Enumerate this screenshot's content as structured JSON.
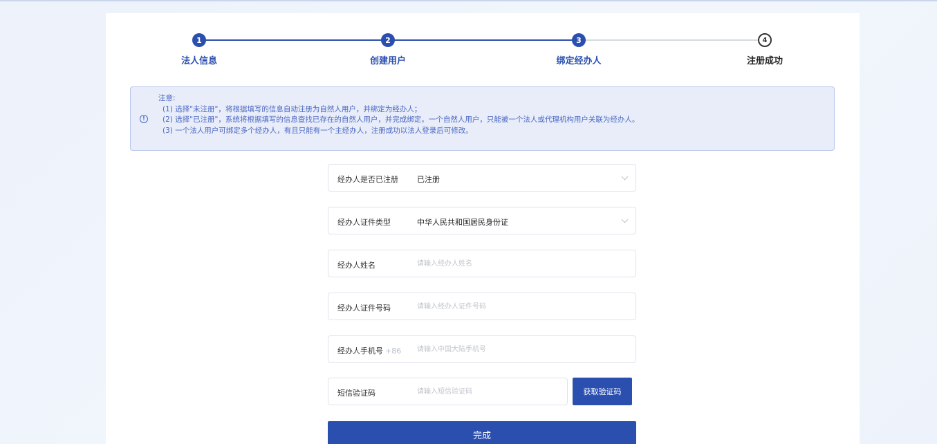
{
  "steps": [
    {
      "num": "1",
      "label": "法人信息",
      "state": "done"
    },
    {
      "num": "2",
      "label": "创建用户",
      "state": "done"
    },
    {
      "num": "3",
      "label": "绑定经办人",
      "state": "active"
    },
    {
      "num": "4",
      "label": "注册成功",
      "state": "pending"
    }
  ],
  "notice": {
    "icon": "info-icon",
    "title": "注意:",
    "lines": [
      "(1) 选择\"未注册\"，将根据填写的信息自动注册为自然人用户，并绑定为经办人；",
      "(2) 选择\"已注册\"，系统将根据填写的信息查找已存在的自然人用户，并完成绑定。一个自然人用户，只能被一个法人或代理机构用户关联为经办人。",
      "(3) 一个法人用户可绑定多个经办人，有且只能有一个主经办人，注册成功以法人登录后可修改。"
    ]
  },
  "form": {
    "registered": {
      "label": "经办人是否已注册",
      "value": "已注册"
    },
    "id_type": {
      "label": "经办人证件类型",
      "value": "中华人民共和国居民身份证"
    },
    "name": {
      "label": "经办人姓名",
      "placeholder": "请输入经办人姓名"
    },
    "id_number": {
      "label": "经办人证件号码",
      "placeholder": "请输入经办人证件号码"
    },
    "phone": {
      "label": "经办人手机号",
      "prefix": "+86",
      "placeholder": "请输入中国大陆手机号"
    },
    "sms": {
      "label": "短信验证码",
      "placeholder": "请输入短信验证码",
      "button": "获取验证码"
    },
    "submit": "完成"
  },
  "colors": {
    "primary": "#2a4fae",
    "notice_bg": "#e8edf9",
    "notice_text": "#4a67c2"
  }
}
